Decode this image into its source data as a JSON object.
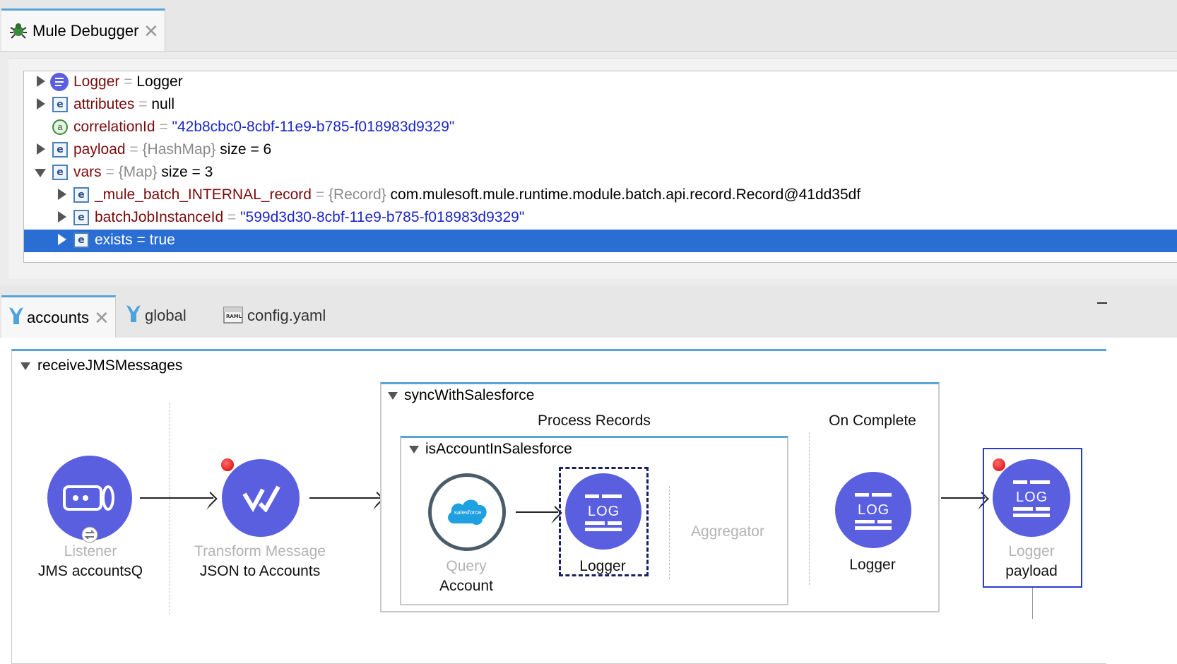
{
  "debugger": {
    "tab_label": "Mule Debugger",
    "rows": [
      {
        "name": "Logger",
        "eq": "=",
        "type": "",
        "value": "Logger",
        "kind": "plain"
      },
      {
        "name": "attributes",
        "eq": "=",
        "type": "",
        "value": "null",
        "kind": "plain"
      },
      {
        "name": "correlationId",
        "eq": "=",
        "type": "",
        "value": "\"42b8cbc0-8cbf-11e9-b785-f018983d9329\"",
        "kind": "string"
      },
      {
        "name": "payload",
        "eq": "=",
        "type": "{HashMap}",
        "value": "size = 6",
        "kind": "plain"
      },
      {
        "name": "vars",
        "eq": "=",
        "type": "{Map}",
        "value": "size = 3",
        "kind": "plain"
      },
      {
        "name": "_mule_batch_INTERNAL_record",
        "eq": "=",
        "type": "{Record}",
        "value": "com.mulesoft.mule.runtime.module.batch.api.record.Record@41dd35df",
        "kind": "plain"
      },
      {
        "name": "batchJobInstanceId",
        "eq": "=",
        "type": "",
        "value": "\"599d3d30-8cbf-11e9-b785-f018983d9329\"",
        "kind": "string"
      },
      {
        "name": "exists",
        "eq": "=",
        "type": "",
        "value": "true",
        "kind": "plain"
      }
    ],
    "icon_letters": {
      "element": "e",
      "attribute": "a"
    }
  },
  "editor": {
    "tabs": [
      {
        "label": "accounts",
        "active": true
      },
      {
        "label": "global",
        "active": false
      },
      {
        "label": "config.yaml",
        "active": false
      }
    ]
  },
  "flow": {
    "name": "receiveJMSMessages",
    "listener": {
      "type": "Listener",
      "label": "JMS accountsQ"
    },
    "transform": {
      "type": "Transform Message",
      "label": "JSON to Accounts"
    },
    "batch": {
      "name": "syncWithSalesforce",
      "process_records": "Process Records",
      "on_complete": "On Complete",
      "step": {
        "name": "isAccountInSalesforce",
        "query": {
          "type": "Query",
          "label": "Account",
          "logo_text": "salesforce"
        },
        "logger": {
          "label": "Logger",
          "icon_text": "LOG"
        },
        "aggregator": "Aggregator"
      },
      "complete_logger": {
        "label": "Logger",
        "icon_text": "LOG"
      }
    },
    "final_logger": {
      "type": "Logger",
      "label": "payload",
      "icon_text": "LOG"
    }
  },
  "colors": {
    "accent_blue": "#5aa3d8",
    "node_purple": "#5a5fe0",
    "selection_blue": "#2a6ed3",
    "breakpoint_red": "#e00000",
    "var_name_red": "#7a0b0b",
    "string_blue": "#1b28c8"
  }
}
